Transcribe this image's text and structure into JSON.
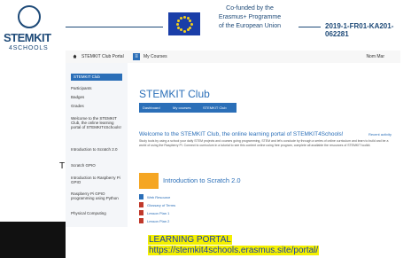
{
  "logo": {
    "text": "STEMKIT",
    "sub": "4SCHOOLS"
  },
  "banner": {
    "cofund_lines": [
      "Co-funded by the",
      "Erasmus+ Programme",
      "of the European Union"
    ],
    "project_code": "2019-1-FR01-KA201-062281",
    "flag_color": "#1a3ea8",
    "star_color": "#f7d117"
  },
  "topbar": {
    "portal": "STEMKIT Club Portal",
    "course": "My Courses",
    "user": "Nom Mar"
  },
  "sidebar": {
    "header": "STEMKIT Club",
    "items": [
      "Participants",
      "Badges",
      "Grades",
      "Welcome to the STEMKIT Club, the online learning portal of STEMKIT4Schools!",
      "Introduction to Scratch 2.0",
      "Scratch GPIO",
      "Introduction to Raspberry Pi GPIO",
      "Raspberry Pi GPIO programming using Python",
      "Physical Computing"
    ]
  },
  "content": {
    "title": "STEMKIT Club",
    "crumbs": [
      "Dashboard",
      "My courses",
      "STEMKIT Club"
    ],
    "welcome": "Welcome to the STEMKIT Club, the online learning portal of STEMKIT4Schools!",
    "more": "Recent activity",
    "body": "Study tools by using a school your daily STEM projects and courses going programming, STEM and let's conclude by through a series of online curriculum and learn to build and be a world of using the Raspberry Pi. Connect to curriculum in a tutorial to see this content online using free program, complete all available the resources of STEMKIT toolkit.",
    "intro_title": "Introduction to Scratch 2.0",
    "resources": [
      {
        "label": "Web Resource",
        "color": "#2b6fb8"
      },
      {
        "label": "Glossary of Terms",
        "color": "#c0392b"
      },
      {
        "label": "Lesson Plan 1",
        "color": "#c0392b"
      },
      {
        "label": "Lesson Plan 2",
        "color": "#c0392b"
      },
      {
        "label": "Lesson Plan 3",
        "color": "#c0392b"
      }
    ]
  },
  "caption": {
    "line1": "LEARNING PORTAL",
    "line2": "https://stemkit4schools.erasmus.site/portal/",
    "highlight_color": "#f4f000"
  },
  "stray_text": "T",
  "colors": {
    "accent": "#2b6fb8",
    "brand": "#1e4a78"
  }
}
